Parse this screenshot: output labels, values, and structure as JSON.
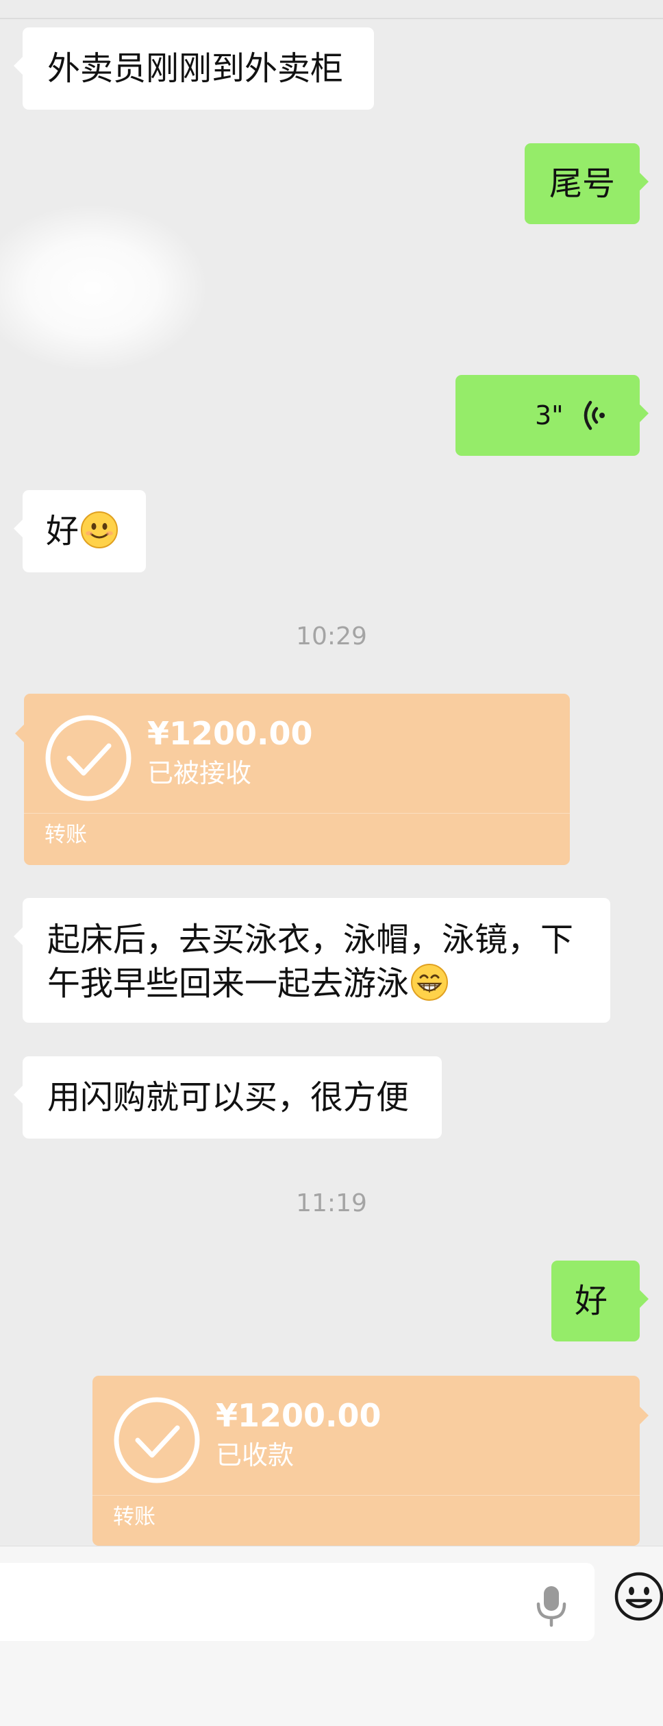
{
  "messages": {
    "m1": {
      "text": "外卖员刚刚到外卖柜"
    },
    "m2": {
      "text": "尾号"
    },
    "voice": {
      "duration": "3\""
    },
    "m4": {
      "text": "好"
    },
    "ts1": "10:29",
    "transfer1": {
      "amount": "¥1200.00",
      "status": "已被接收",
      "label": "转账"
    },
    "m5": {
      "line1": "起床后，去买泳衣，泳帽，泳镜，下",
      "line2": "午我早些回来一起去游泳"
    },
    "m6": {
      "text": "用闪购就可以买，很方便"
    },
    "ts2": "11:19",
    "m7": {
      "text": "好"
    },
    "transfer2": {
      "amount": "¥1200.00",
      "status": "已收款",
      "label": "转账"
    }
  },
  "icons": {
    "voice": "voice-wave-icon",
    "smile": "smiling-face-emoji",
    "grin": "grinning-face-emoji",
    "check": "check-circle-icon",
    "mic": "microphone-icon",
    "emoji": "emoji-icon"
  },
  "colors": {
    "sent_bubble": "#95ec69",
    "received_bubble": "#ffffff",
    "transfer_card": "#f9cd9f",
    "background": "#ececec",
    "timestamp": "#a4a4a4"
  }
}
